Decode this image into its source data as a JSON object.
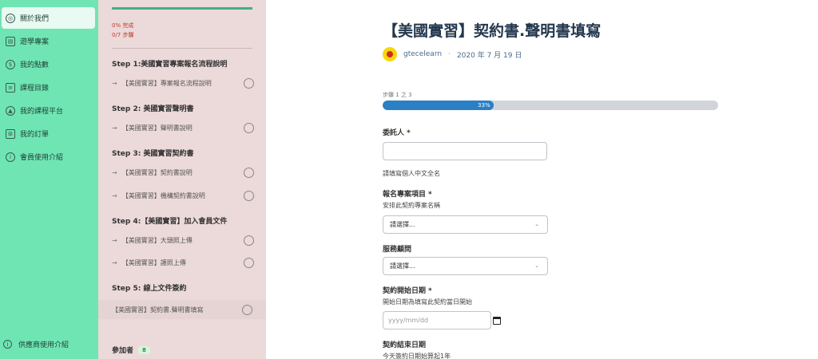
{
  "nav": {
    "items": [
      {
        "label": "關於我們"
      },
      {
        "label": "遊學專案"
      },
      {
        "label": "我的點數"
      },
      {
        "label": "課程目錄"
      },
      {
        "label": "我的課程平台"
      },
      {
        "label": "我的訂單"
      },
      {
        "label": "會員使用介紹"
      }
    ],
    "bottom_label": "供應商使用介紹"
  },
  "course": {
    "progress_percent": "0% 完成",
    "progress_steps": "0/7 步驟",
    "steps": [
      {
        "title": "Step 1:美國實習專案報名流程說明"
      },
      {
        "title": "Step 2: 美國實習聲明書"
      },
      {
        "title": "Step 3: 美國實習契約書"
      },
      {
        "title": "Step 4:【美國實習】加入會員文件"
      },
      {
        "title": "Step 5: 線上文件簽約"
      }
    ],
    "lessons": [
      {
        "label": "【美國實習】專案報名流程說明"
      },
      {
        "label": "【美國實習】聲明書說明"
      },
      {
        "label": "【美國實習】契約書說明"
      },
      {
        "label": "【美國實習】機構契約書說明"
      },
      {
        "label": "【美國實習】大頭照上傳"
      },
      {
        "label": "【美國實習】護照上傳"
      },
      {
        "label": "【美國實習】契約書.聲明書填寫"
      }
    ],
    "participants_label": "參加者",
    "participants_count": "8"
  },
  "main": {
    "title": "【美國實習】契約書.聲明書填寫",
    "author": "gtecelearn",
    "date": "2020 年 7 月 19 日",
    "step_of": "步驟 1 之 3",
    "progress": "33%",
    "progress_value": 0.33,
    "fields": {
      "client_label": "委託人",
      "client_value": "",
      "client_hint": "請填寫個人中文全名",
      "project_label": "報名專案項目",
      "project_hint": "安排此契約專案名稱",
      "project_value": "請選擇...",
      "advisor_label": "服務顧問",
      "advisor_value": "請選擇...",
      "start_label": "契約開始日期",
      "start_hint": "開始日期為填寫此契約當日開始",
      "start_placeholder": "yyyy/mm/dd",
      "end_label": "契約結束日期",
      "end_hint": "今天簽約日期始算起1年"
    },
    "required_mark": "*"
  },
  "colors": {
    "nav_bg": "#6fe5b3",
    "course_bg": "#ecd9d9",
    "progress_fill": "#2b7fc5",
    "title": "#23384d"
  }
}
